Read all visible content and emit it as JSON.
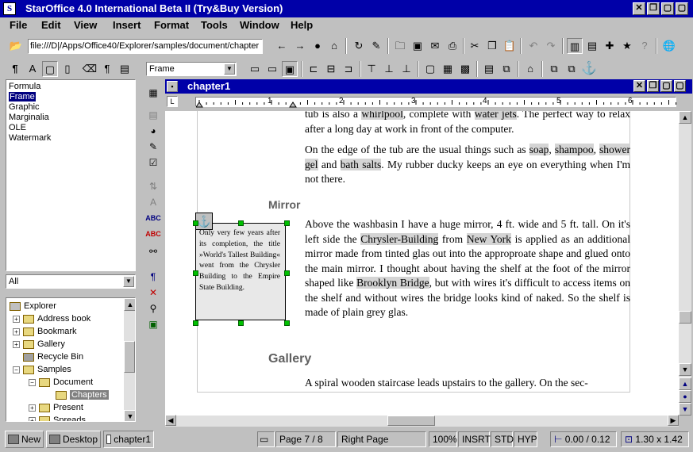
{
  "app": {
    "title": "StarOffice 4.0  International Beta II (Try&Buy Version)",
    "icon": "S"
  },
  "window_controls": {
    "close": "✕",
    "restore": "❐",
    "minimize": "▢"
  },
  "menu": [
    "File",
    "Edit",
    "View",
    "Insert",
    "Format",
    "Tools",
    "Window",
    "Help"
  ],
  "url": {
    "value": "file:///D|/Apps/Office40/Explorer/samples/document/chapter"
  },
  "format_toolbar": {
    "frame_style": "Frame"
  },
  "stylist": {
    "items": [
      "Formula",
      "Frame",
      "Graphic",
      "Marginalia",
      "OLE",
      "Watermark"
    ],
    "selected": "Frame",
    "filter": "All"
  },
  "explorer": {
    "items": [
      {
        "label": "Explorer",
        "level": 0,
        "toggle": ""
      },
      {
        "label": "Address book",
        "level": 1,
        "toggle": "+"
      },
      {
        "label": "Bookmark",
        "level": 1,
        "toggle": "+"
      },
      {
        "label": "Gallery",
        "level": 1,
        "toggle": "+"
      },
      {
        "label": "Recycle Bin",
        "level": 1,
        "toggle": ""
      },
      {
        "label": "Samples",
        "level": 1,
        "toggle": "−"
      },
      {
        "label": "Document",
        "level": 2,
        "toggle": "−"
      },
      {
        "label": "Chapters",
        "level": 3,
        "toggle": "",
        "selected": true
      },
      {
        "label": "Present",
        "level": 2,
        "toggle": "+"
      },
      {
        "label": "Spreads",
        "level": 2,
        "toggle": "+"
      }
    ]
  },
  "document": {
    "title": "chapter1",
    "ruler_numbers": [
      "1",
      "2",
      "3",
      "4",
      "5",
      "6"
    ],
    "para1": [
      "tub is also a ",
      "whirlpool",
      ", complete with ",
      "water jets",
      ". The perfect way to relax after a long day at work in front of the computer."
    ],
    "para2": [
      "On the edge of the tub are the usual things such as ",
      "soap",
      ", ",
      "shampoo",
      ", ",
      "shower gel",
      " and ",
      "bath salts",
      ". My rubber ducky keeps an eye on everything when I'm not there."
    ],
    "heading_mirror": "Mirror",
    "para3": [
      "Above the washbasin I have a huge mirror, 4 ft. wide and 5 ft. tall. On it's left side the ",
      "Chrysler-Building",
      " from ",
      "New York",
      " is applied as an additional mirror made from tinted glas out into the approproate shape and glued onto the main mirror. I thought about having the shelf at the foot of the mirror shaped like ",
      "Brooklyn Bridge",
      ", but with wires it's difficult to access items on the shelf and without wires the bridge looks kind of naked. So the shelf is made of plain grey glas."
    ],
    "frame_text": "Only very few years after its completion, the title »World's Tallest Building« went from the Chrysler Building to the Empire State Building.",
    "heading_gallery": "Gallery",
    "para4": "A spiral wooden staircase leads upstairs to the gallery. On the sec-"
  },
  "taskbar": {
    "new": "New",
    "desktop": "Desktop",
    "doc": "chapter1"
  },
  "status": {
    "page": "Page 7 / 8",
    "page_style": "Right Page",
    "zoom": "100%",
    "insert_mode": "INSRT",
    "selection_mode": "STD",
    "hyperlink_mode": "HYP",
    "position": "0.00 / 0.12",
    "size": "1.30 x 1.42"
  },
  "colors": {
    "title_bar": "#0000a8",
    "chrome": "#c0c0c0",
    "field_shading": "#d4d4d4",
    "handle": "#00c000"
  }
}
